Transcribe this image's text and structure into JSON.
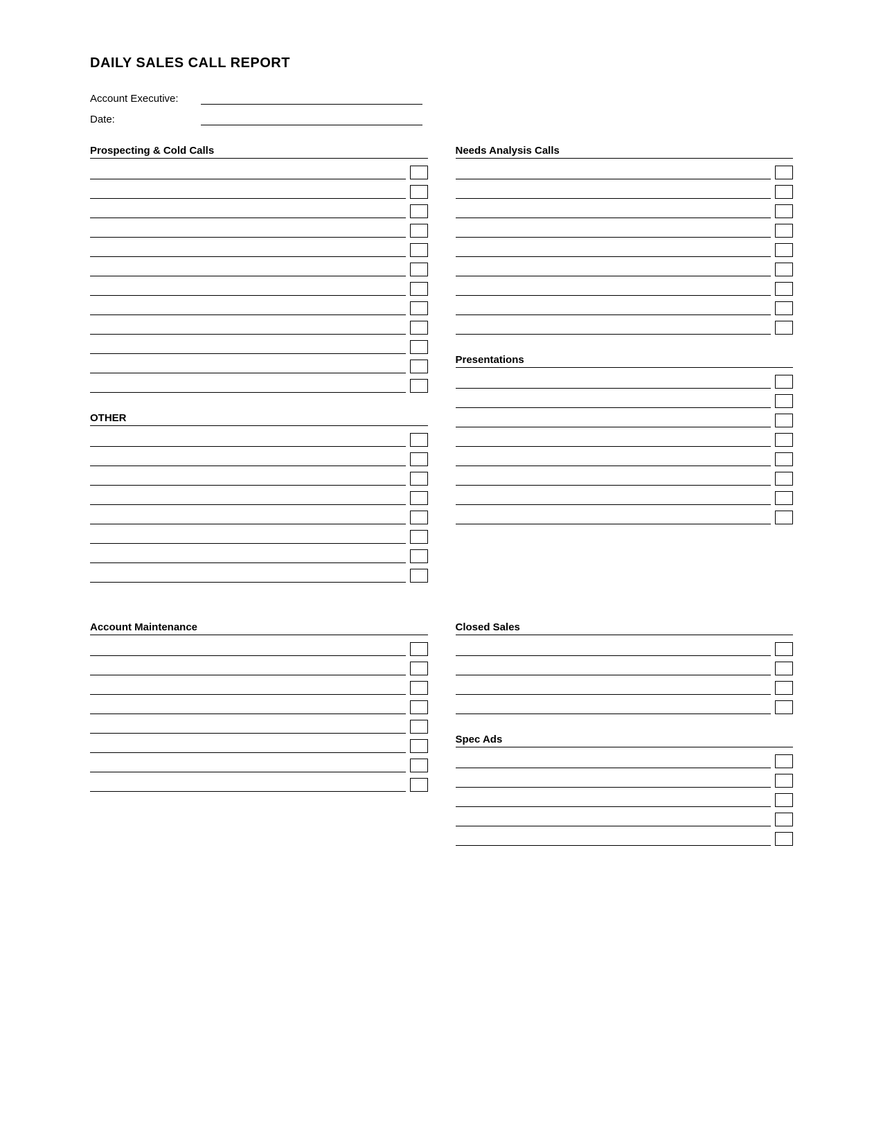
{
  "title": "DAILY SALES CALL REPORT",
  "header": {
    "account_executive_label": "Account Executive:",
    "date_label": "Date:"
  },
  "sections": {
    "prospecting": {
      "title": "Prospecting & Cold Calls",
      "rows": 12
    },
    "other": {
      "title": "OTHER",
      "rows": 8
    },
    "needs_analysis": {
      "title": "Needs Analysis Calls",
      "rows": 9
    },
    "presentations": {
      "title": "Presentations",
      "rows": 8
    },
    "account_maintenance": {
      "title": "Account Maintenance",
      "rows": 8
    },
    "closed_sales": {
      "title": "Closed Sales",
      "rows": 4
    },
    "spec_ads": {
      "title": "Spec Ads",
      "rows": 5
    }
  }
}
